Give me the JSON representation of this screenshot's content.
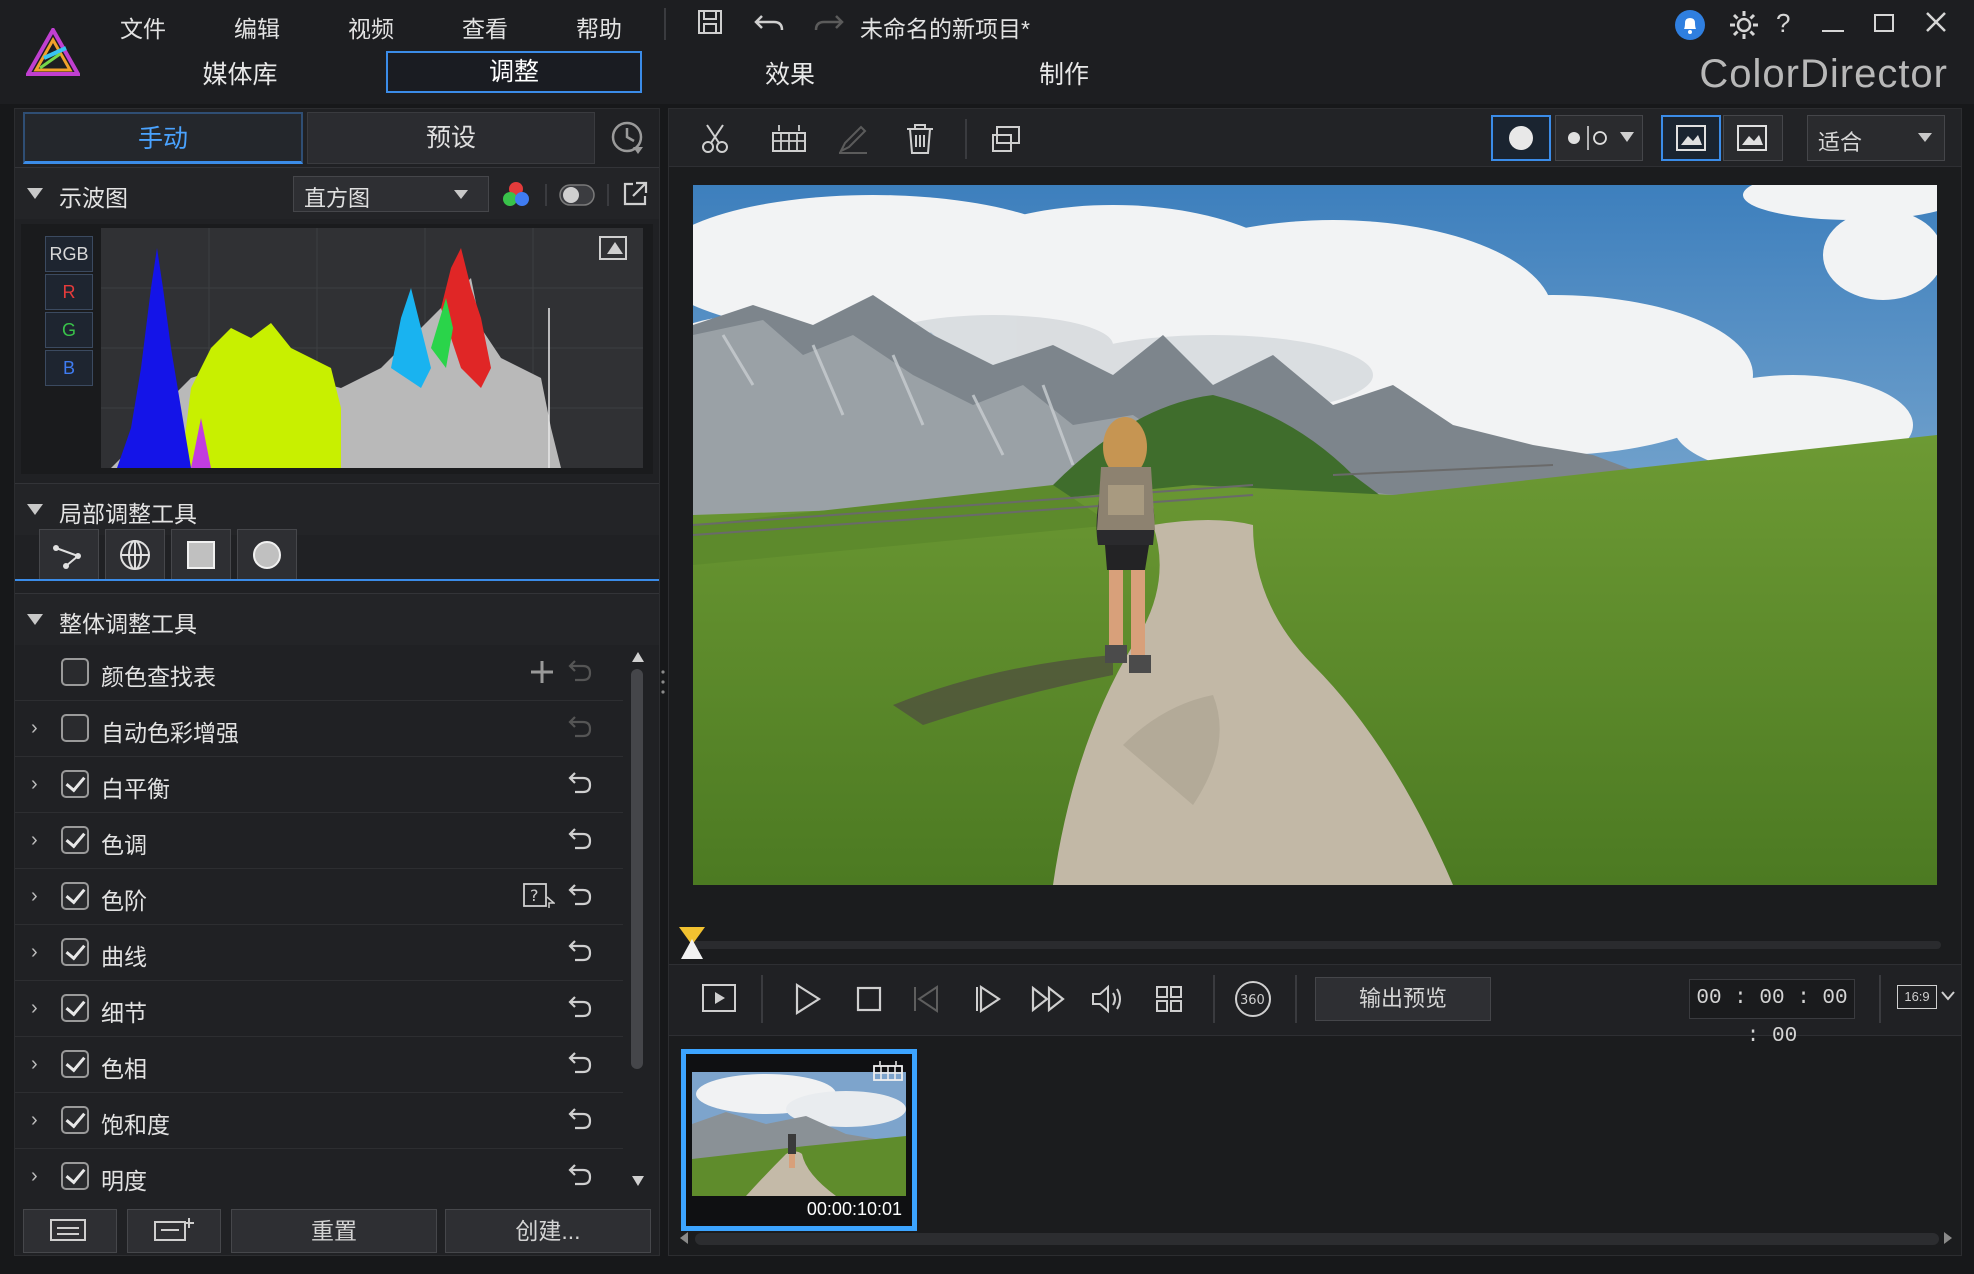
{
  "app": {
    "brand": "ColorDirector",
    "project_title": "未命名的新项目*"
  },
  "menu": [
    "文件",
    "编辑",
    "视频",
    "查看",
    "帮助"
  ],
  "modes": {
    "library": "媒体库",
    "adjust": "调整",
    "effects": "效果",
    "produce": "制作",
    "active": "调整"
  },
  "left": {
    "tabs": {
      "manual": "手动",
      "preset": "预设",
      "active": "手动"
    },
    "waveform": {
      "title": "示波图",
      "dropdown_value": "直方图",
      "channels": [
        "RGB",
        "R",
        "G",
        "B"
      ],
      "channel_colors": [
        "#e0e0e0",
        "#e53b3b",
        "#39c24a",
        "#3f7cf2"
      ]
    },
    "local_tools": {
      "title": "局部调整工具"
    },
    "global_tools": {
      "title": "整体调整工具",
      "items": [
        {
          "label": "颜色查找表",
          "checked": false,
          "expandable": false
        },
        {
          "label": "自动色彩增强",
          "checked": false,
          "expandable": true
        },
        {
          "label": "白平衡",
          "checked": true,
          "expandable": true
        },
        {
          "label": "色调",
          "checked": true,
          "expandable": true
        },
        {
          "label": "色阶",
          "checked": true,
          "expandable": true
        },
        {
          "label": "曲线",
          "checked": true,
          "expandable": true
        },
        {
          "label": "细节",
          "checked": true,
          "expandable": true
        },
        {
          "label": "色相",
          "checked": true,
          "expandable": true
        },
        {
          "label": "饱和度",
          "checked": true,
          "expandable": true
        },
        {
          "label": "明度",
          "checked": true,
          "expandable": true
        }
      ]
    },
    "buttons": {
      "reset": "重置",
      "create": "创建..."
    }
  },
  "preview": {
    "fit_option": "适合",
    "output_preview": "输出预览",
    "timecode": "00 : 00 : 00 : 00",
    "aspect": "16:9",
    "icon_360": "360"
  },
  "clip": {
    "duration": "00:00:10:01"
  },
  "colors": {
    "accent": "#3b8ce8",
    "clip_border": "#3ca4ff",
    "playhead": "#f2c230"
  }
}
